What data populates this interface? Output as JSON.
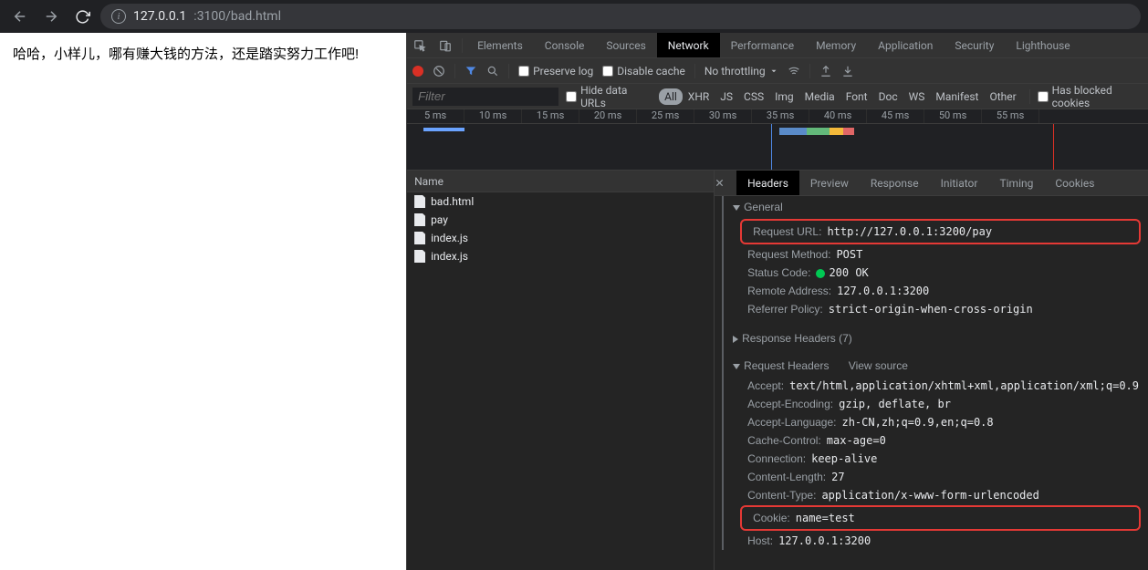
{
  "url": {
    "host": "127.0.0.1",
    "port_path": ":3100/bad.html"
  },
  "page_text": "哈哈，小样儿，哪有赚大钱的方法，还是踏实努力工作吧!",
  "tabs": [
    "Elements",
    "Console",
    "Sources",
    "Network",
    "Performance",
    "Memory",
    "Application",
    "Security",
    "Lighthouse"
  ],
  "tabs_active": 3,
  "toolbar": {
    "preserve_log": "Preserve log",
    "disable_cache": "Disable cache",
    "throttling": "No throttling"
  },
  "filter": {
    "placeholder": "Filter",
    "hide_data_urls": "Hide data URLs",
    "types": [
      "All",
      "XHR",
      "JS",
      "CSS",
      "Img",
      "Media",
      "Font",
      "Doc",
      "WS",
      "Manifest",
      "Other"
    ],
    "has_blocked": "Has blocked cookies"
  },
  "timeline_ticks": [
    "5 ms",
    "10 ms",
    "15 ms",
    "20 ms",
    "25 ms",
    "30 ms",
    "35 ms",
    "40 ms",
    "45 ms",
    "50 ms",
    "55 ms"
  ],
  "req_header": "Name",
  "requests": [
    {
      "name": "bad.html"
    },
    {
      "name": "pay"
    },
    {
      "name": "index.js"
    },
    {
      "name": "index.js"
    }
  ],
  "details_tabs": [
    "Headers",
    "Preview",
    "Response",
    "Initiator",
    "Timing",
    "Cookies"
  ],
  "details_tabs_active": 0,
  "sections": {
    "general": {
      "title": "General",
      "request_url_k": "Request URL:",
      "request_url_v": "http://127.0.0.1:3200/pay",
      "method_k": "Request Method:",
      "method_v": "POST",
      "status_k": "Status Code:",
      "status_v": "200 OK",
      "remote_k": "Remote Address:",
      "remote_v": "127.0.0.1:3200",
      "ref_k": "Referrer Policy:",
      "ref_v": "strict-origin-when-cross-origin"
    },
    "response_headers": {
      "title": "Response Headers (7)"
    },
    "request_headers": {
      "title": "Request Headers",
      "view_source": "View source",
      "rows": [
        {
          "k": "Accept:",
          "v": "text/html,application/xhtml+xml,application/xml;q=0.9"
        },
        {
          "k": "Accept-Encoding:",
          "v": "gzip, deflate, br"
        },
        {
          "k": "Accept-Language:",
          "v": "zh-CN,zh;q=0.9,en;q=0.8"
        },
        {
          "k": "Cache-Control:",
          "v": "max-age=0"
        },
        {
          "k": "Connection:",
          "v": "keep-alive"
        },
        {
          "k": "Content-Length:",
          "v": "27"
        },
        {
          "k": "Content-Type:",
          "v": "application/x-www-form-urlencoded"
        }
      ],
      "cookie_k": "Cookie:",
      "cookie_v": "name=test",
      "host_k": "Host:",
      "host_v": "127.0.0.1:3200"
    }
  }
}
